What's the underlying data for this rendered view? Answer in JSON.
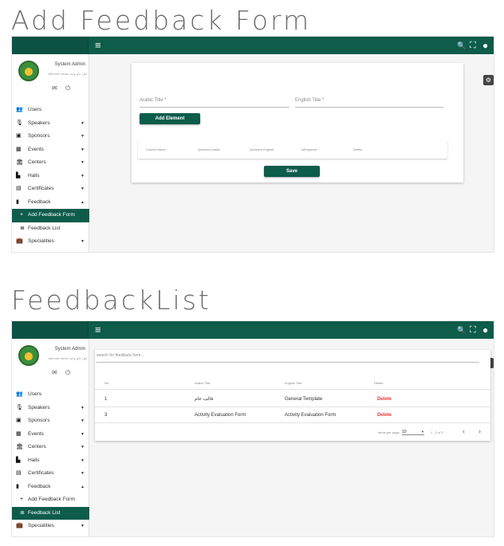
{
  "sections": [
    {
      "title": "Add Feedback Form"
    },
    {
      "title": "FeedbackList"
    }
  ],
  "topbar": {
    "menu_icon": "≡",
    "search_icon": "🔍",
    "fullscreen_icon": "⛶",
    "account_icon": "●"
  },
  "profile": {
    "name": "System Admin",
    "member_since": "Member since قبل عام واحد"
  },
  "nav": [
    {
      "label": "Users",
      "icon": "👥",
      "chevron": ""
    },
    {
      "label": "Speakers",
      "icon": "🎙",
      "chevron": "▼"
    },
    {
      "label": "Sponsors",
      "icon": "▣",
      "chevron": "▼"
    },
    {
      "label": "Events",
      "icon": "▦",
      "chevron": "▼"
    },
    {
      "label": "Centers",
      "icon": "🏛",
      "chevron": "▼"
    },
    {
      "label": "Halls",
      "icon": "▙",
      "chevron": "▼"
    },
    {
      "label": "Certificates",
      "icon": "▤",
      "chevron": "▼"
    },
    {
      "label": "Feedback",
      "icon": "▮",
      "chevron": "▲"
    }
  ],
  "nav_sub": [
    {
      "label": "Add Feedback Form",
      "icon": "+"
    },
    {
      "label": "Feedback List",
      "icon": "≣"
    }
  ],
  "nav_last": {
    "label": "Specialities",
    "icon": "💼",
    "chevron": "▼"
  },
  "add_form": {
    "arabic_title_placeholder": "Arabic Title *",
    "english_title_placeholder": "English Title *",
    "add_element_label": "Add Element",
    "columns": [
      "Control Name",
      "Question Arabic",
      "Question English",
      "isRequired",
      "Delete"
    ],
    "save_label": "Save"
  },
  "list": {
    "search_placeholder": "search for feedback form...",
    "columns": [
      "No.",
      "Arabic Title",
      "English Title",
      "Delete"
    ],
    "rows": [
      {
        "no": "1",
        "arabic": "قالب عام",
        "english": "General Template",
        "action": "Delete"
      },
      {
        "no": "3",
        "arabic": "Activity Evaluation Form",
        "english": "Activity Evaluation Form",
        "action": "Delete"
      }
    ],
    "paginator": {
      "items_per_page_label": "Items per page:",
      "page_size": "10",
      "range": "1 - 2 of 2",
      "prev": "‹",
      "next": "›"
    }
  },
  "colors": {
    "brand": "#0e5c4a",
    "delete": "#e53935"
  }
}
